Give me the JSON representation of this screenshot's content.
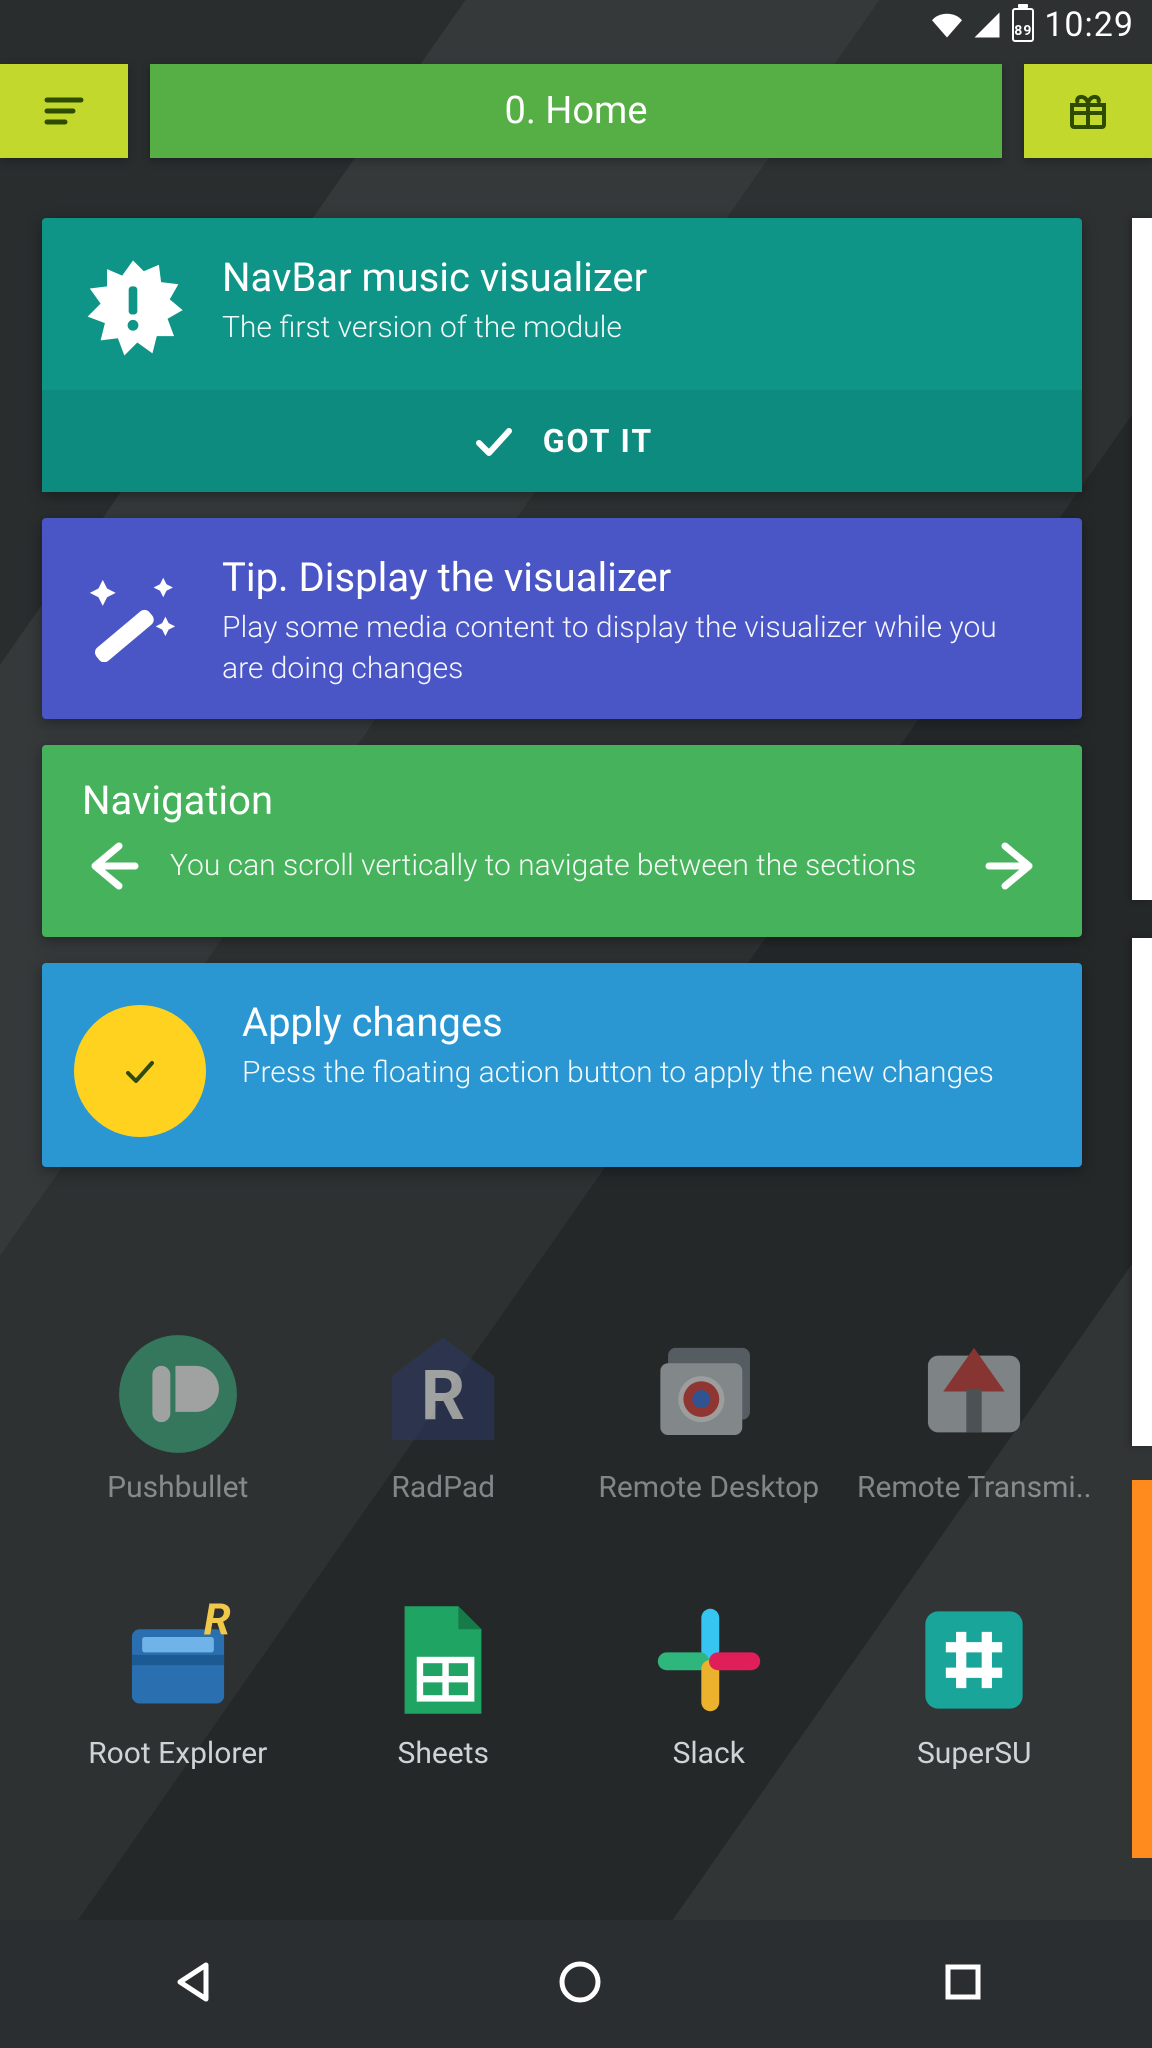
{
  "status": {
    "battery": "89",
    "time": "10:29"
  },
  "header": {
    "title": "0. Home"
  },
  "card_intro": {
    "title": "NavBar music visualizer",
    "subtitle": "The first version of the module",
    "action": "GOT IT"
  },
  "card_tip": {
    "title": "Tip. Display the visualizer",
    "subtitle": "Play some media content to display the visualizer while you are doing changes"
  },
  "card_nav": {
    "title": "Navigation",
    "subtitle": "You can scroll vertically to navigate between the sections"
  },
  "card_apply": {
    "title": "Apply changes",
    "subtitle": "Press the floating action button to apply the new changes"
  },
  "launcher": {
    "row1": [
      "Pushbullet",
      "RadPad",
      "Remote Desktop",
      "Remote Transmi.."
    ],
    "row2": [
      "Root Explorer",
      "Sheets",
      "Slack",
      "SuperSU"
    ]
  }
}
